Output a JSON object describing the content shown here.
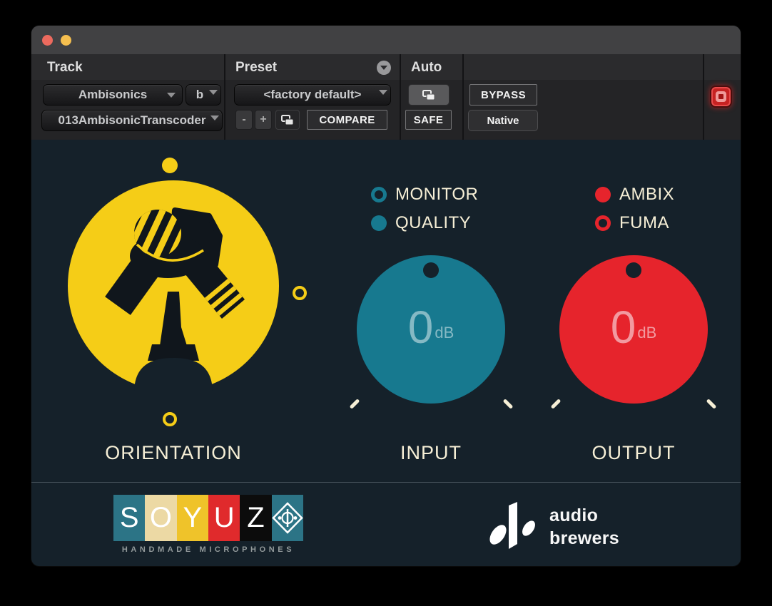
{
  "header": {
    "track_label": "Track",
    "track_name": "Ambisonics",
    "track_group": "b",
    "plugin_name": "013AmbisonicTranscoder",
    "preset_label": "Preset",
    "preset_value": "<factory default>",
    "preset_prev": "-",
    "preset_next": "+",
    "compare_label": "COMPARE",
    "auto_label": "Auto",
    "safe_label": "SAFE",
    "bypass_label": "BYPASS",
    "native_label": "Native"
  },
  "main": {
    "orientation_label": "ORIENTATION",
    "input_label": "INPUT",
    "output_label": "OUTPUT",
    "input_mode_options": [
      {
        "label": "MONITOR",
        "selected": false
      },
      {
        "label": "QUALITY",
        "selected": true
      }
    ],
    "output_format_options": [
      {
        "label": "AMBIX",
        "selected": true
      },
      {
        "label": "FUMA",
        "selected": false
      }
    ],
    "input_gain": {
      "value": "0",
      "unit": "dB"
    },
    "output_gain": {
      "value": "0",
      "unit": "dB"
    }
  },
  "footer": {
    "soyuz_letters": [
      "S",
      "O",
      "Y",
      "U",
      "Z"
    ],
    "soyuz_tagline": "HANDMADE MICROPHONES",
    "brand_name_line1": "audio",
    "brand_name_line2": "brewers"
  },
  "icons": {
    "preset_menu": "circle-chevron-down",
    "dropdown_arrow": "chevron-down",
    "preset_librarian": "overlapping-squares",
    "auto_librarian": "overlapping-squares",
    "plugin_target": "red-target-square",
    "soyuz_emblem": "diamond-badge",
    "audio_brewers_mark": "drops-and-bar",
    "orientation_mic": "ambisonic-microphone"
  },
  "colors": {
    "teal": "#17798f",
    "red": "#e6242c",
    "yellow": "#f5cd17",
    "cream": "#f6efd6",
    "panel_bg": "#15212a"
  }
}
